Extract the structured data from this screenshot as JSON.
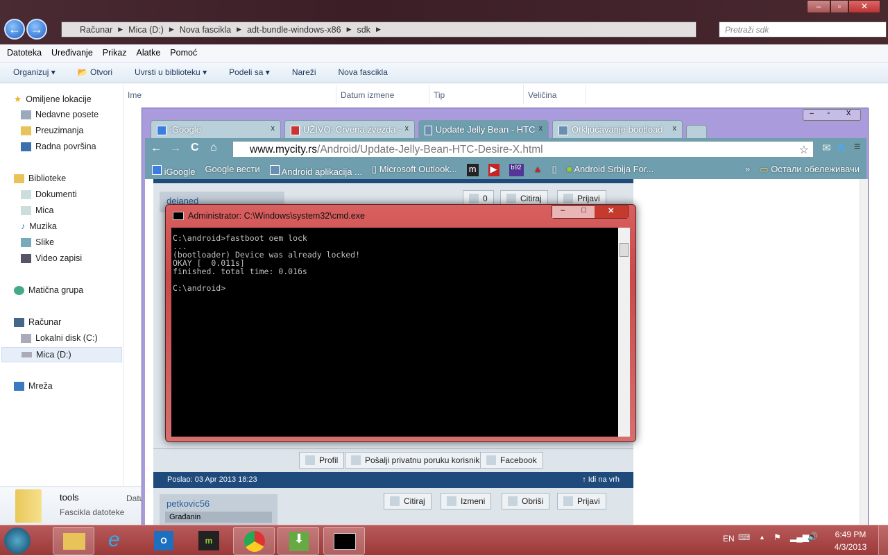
{
  "explorer": {
    "breadcrumb": [
      "Računar",
      "Mica (D:)",
      "Nova fascikla",
      "adt-bundle-windows-x86",
      "sdk"
    ],
    "search_placeholder": "Pretraži sdk",
    "menu": [
      "Datoteka",
      "Uređivanje",
      "Prikaz",
      "Alatke",
      "Pomoć"
    ],
    "toolbar": {
      "organize": "Organizuj",
      "open": "Otvori",
      "include": "Uvrsti u biblioteku",
      "share": "Podeli sa",
      "burn": "Nareži",
      "new_folder": "Nova fascikla"
    },
    "columns": [
      "Ime",
      "Datum izmene",
      "Tip",
      "Veličina"
    ],
    "nav": {
      "favorites": "Omiljene lokacije",
      "recent": "Nedavne posete",
      "downloads": "Preuzimanja",
      "desktop": "Radna površina",
      "libraries": "Biblioteke",
      "documents": "Dokumenti",
      "mica": "Mica",
      "music": "Muzika",
      "pictures": "Slike",
      "videos": "Video zapisi",
      "homegroup": "Matična grupa",
      "computer": "Računar",
      "disk_c": "Lokalni disk (C:)",
      "disk_d": "Mica (D:)",
      "network": "Mreža"
    },
    "details": {
      "name": "tools",
      "type": "Fascikla datoteke",
      "date_label": "Datu"
    }
  },
  "chrome": {
    "tabs": [
      {
        "label": "iGoogle"
      },
      {
        "label": "UŽIVO: Crvena zvezda -"
      },
      {
        "label": "Update Jelly Bean - HTC"
      },
      {
        "label": "Otključavanje bootload"
      }
    ],
    "url_host": "www.mycity.rs",
    "url_path": "/Android/Update-Jelly-Bean-HTC-Desire-X.html",
    "bookmarks": [
      "iGoogle",
      "Google вести",
      "Android aplikacija ...",
      "Microsoft Outlook...",
      "Android Srbija For..."
    ],
    "other_bookmarks": "Остали обележивачи",
    "page": {
      "user1": "dejaned",
      "likes": "0",
      "quote": "Citiraj",
      "report": "Prijavi",
      "profile": "Profil",
      "pm": "Pošalji privatnu poruku korisniku",
      "facebook": "Facebook",
      "posted": "Poslao: 03 Apr 2013 18:23",
      "top": "Idi na vrh",
      "user2": "petkovic56",
      "rank": "Građanin",
      "edit": "Izmeni",
      "delete": "Obriši"
    }
  },
  "cmd": {
    "title": "Administrator: C:\\Windows\\system32\\cmd.exe",
    "output": "C:\\android>fastboot oem lock\n...\n(bootloader) Device was already locked!\nOKAY [  0.011s]\nfinished. total time: 0.016s\n\nC:\\android>"
  },
  "taskbar": {
    "lang": "EN",
    "time": "6:49 PM",
    "date": "4/3/2013"
  }
}
